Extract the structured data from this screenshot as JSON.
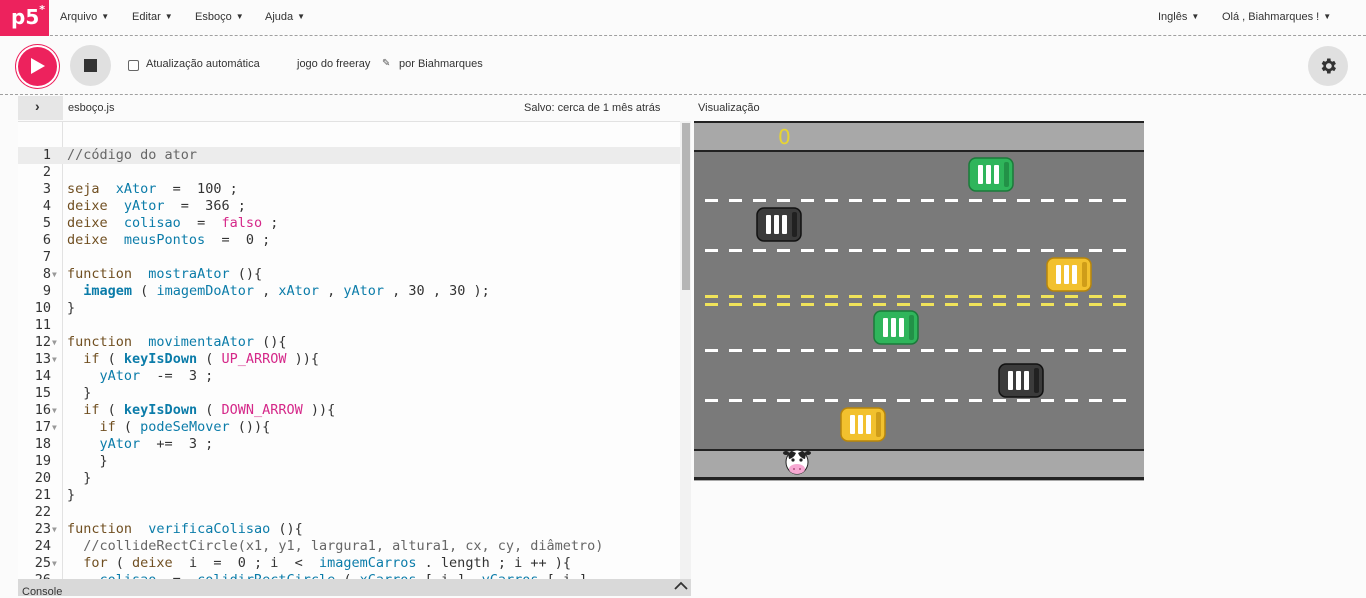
{
  "nav": {
    "logo": "p5",
    "logo_star": "*",
    "menu": [
      "Arquivo",
      "Editar",
      "Esboço",
      "Ajuda"
    ],
    "language": "Inglês",
    "user": "Olá , Biahmarques !"
  },
  "toolbar": {
    "auto_refresh_label": "Atualização automática",
    "auto_refresh_checked": false,
    "project_name": "jogo do freeray",
    "byline": "por Biahmarques"
  },
  "editor": {
    "file_name": "esboço.js",
    "saved_status": "Salvo: cerca de 1 mês atrás",
    "preview_label": "Visualização",
    "console_label": "Console"
  },
  "code_lines": [
    {
      "n": "1",
      "text": "//código do ator"
    },
    {
      "n": "2",
      "text": ""
    },
    {
      "n": "3",
      "text": "seja  xAtor  =  100 ;"
    },
    {
      "n": "4",
      "text": "deixe  yAtor  =  366 ;"
    },
    {
      "n": "5",
      "text": "deixe  colisao  =  falso ;"
    },
    {
      "n": "6",
      "text": "deixe  meusPontos  =  0 ;"
    },
    {
      "n": "7",
      "text": ""
    },
    {
      "n": "8",
      "text": "function  mostraAtor (){"
    },
    {
      "n": "9",
      "text": "  imagem ( imagemDoAtor , xAtor , yAtor , 30 , 30 );"
    },
    {
      "n": "10",
      "text": "}"
    },
    {
      "n": "11",
      "text": ""
    },
    {
      "n": "12",
      "text": "function  movimentaAtor (){"
    },
    {
      "n": "13",
      "text": "  if ( keyIsDown ( UP_ARROW )){"
    },
    {
      "n": "14",
      "text": "    yAtor  -=  3 ;"
    },
    {
      "n": "15",
      "text": "  }"
    },
    {
      "n": "16",
      "text": "  if ( keyIsDown ( DOWN_ARROW )){"
    },
    {
      "n": "17",
      "text": "    if ( podeSeMover ()){"
    },
    {
      "n": "18",
      "text": "    yAtor  +=  3 ;"
    },
    {
      "n": "19",
      "text": "    }"
    },
    {
      "n": "20",
      "text": "  }"
    },
    {
      "n": "21",
      "text": "}"
    },
    {
      "n": "22",
      "text": ""
    },
    {
      "n": "23",
      "text": "function  verificaColisao (){"
    },
    {
      "n": "24",
      "text": "  //collideRectCircle(x1, y1, largura1, altura1, cx, cy, diâmetro)"
    },
    {
      "n": "25",
      "text": "  for ( deixe  i  =  0 ; i  <  imagemCarros . length ; i ++ ){"
    },
    {
      "n": "26",
      "text": "    colisao  =  colidirRectCircle ( xCarros [ i ], yCarros [ i ]"
    }
  ],
  "game": {
    "score": "0",
    "colors": {
      "road": "#7a7a7a",
      "sidewalk": "#a8a8a8",
      "score": "#e8d530",
      "lane": "#ffffff",
      "center": "#f0e35a"
    },
    "cars": [
      {
        "color": "green",
        "lane": 1
      },
      {
        "color": "black",
        "lane": 2
      },
      {
        "color": "yellow",
        "lane": 3
      },
      {
        "color": "green",
        "lane": 4
      },
      {
        "color": "black",
        "lane": 5
      },
      {
        "color": "yellow",
        "lane": 6
      }
    ]
  }
}
